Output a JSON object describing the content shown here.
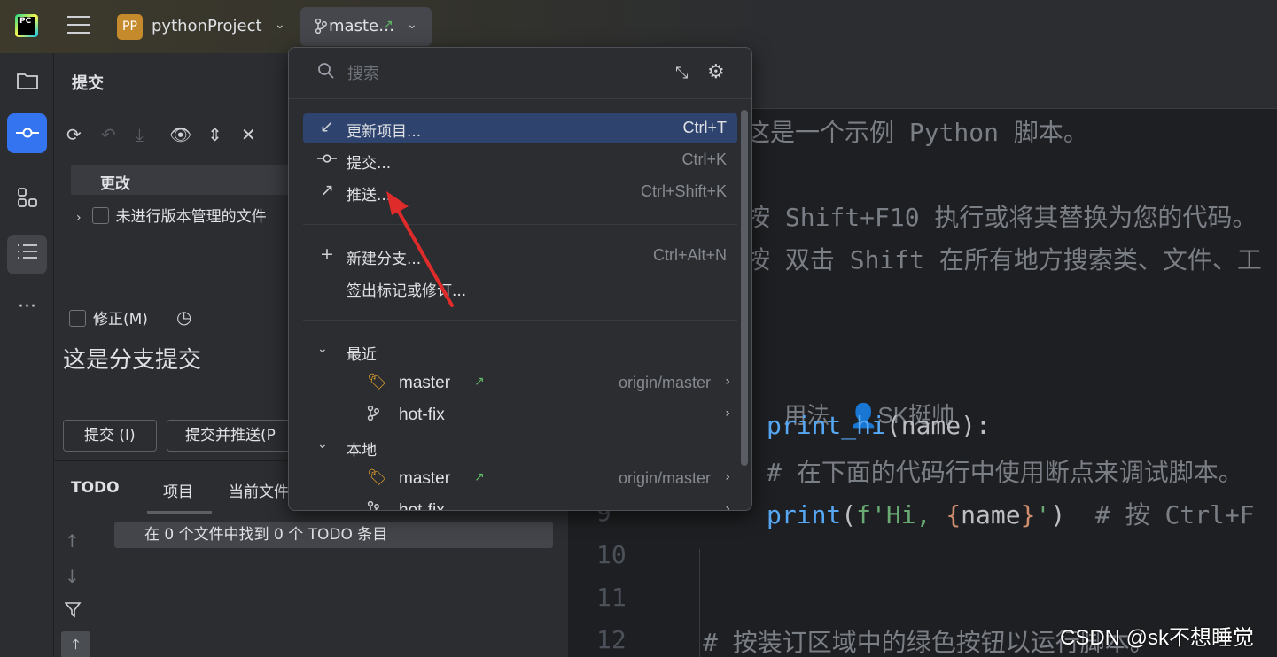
{
  "titlebar": {
    "logo_text": "PC",
    "project_badge": "PP",
    "project_name": "pythonProject",
    "branch_name": "maste…",
    "accent_color": "#3574f0"
  },
  "toolstrip": {
    "items": [
      "folder-icon",
      "commit-icon",
      "structure-icon",
      "list-icon",
      "more-icon"
    ],
    "more_label": "···"
  },
  "commit_panel": {
    "title": "提交",
    "changes_header": "更改",
    "unversioned_label": "未进行版本管理的文件",
    "amend_label": "修正(M)",
    "message": "这是分支提交",
    "commit_button": "提交 (I)",
    "commit_push_button": "提交并推送(P"
  },
  "todo_panel": {
    "tabs": [
      "TODO",
      "项目",
      "当前文件"
    ],
    "result_text": "在 0 个文件中找到 0 个 TODO 条目"
  },
  "editor": {
    "lines": [
      {
        "kind": "comment",
        "text": "这是一个示例 Python 脚本。"
      },
      {
        "kind": "comment",
        "text": "按 Shift+F10 执行或将其替换为您的代码。"
      },
      {
        "kind": "comment",
        "text": "按 双击 Shift 在所有地方搜索类、文件、工"
      },
      {
        "kind": "inlay",
        "usage": "用法",
        "author": "SK挺帅"
      },
      {
        "kind": "def",
        "fn": "print_hi",
        "rest": "(name):"
      },
      {
        "kind": "comment",
        "text": "# 在下面的代码行中使用断点来调试脚本。"
      },
      {
        "kind": "print",
        "fn": "print",
        "open": "(",
        "str1": "f'Hi, ",
        "brace1": "{",
        "var": "name",
        "brace2": "}",
        "str2": "'",
        "close": ")",
        "comment": "  # 按 Ctrl+F"
      },
      {
        "kind": "comment",
        "text": "# 按装订区域中的绿色按钮以运行脚本。"
      }
    ],
    "line_numbers": [
      "9",
      "10",
      "11",
      "12"
    ]
  },
  "popup": {
    "search_placeholder": "搜索",
    "actions": [
      {
        "icon": "update-icon",
        "label": "更新项目...",
        "shortcut": "Ctrl+T",
        "selected": true
      },
      {
        "icon": "commit-icon",
        "label": "提交...",
        "shortcut": "Ctrl+K",
        "selected": false
      },
      {
        "icon": "push-icon",
        "label": "推送...",
        "shortcut": "Ctrl+Shift+K",
        "selected": false
      }
    ],
    "actions2": [
      {
        "icon": "plus-icon",
        "label": "新建分支...",
        "shortcut": "Ctrl+Alt+N"
      },
      {
        "icon": "",
        "label": "签出标记或修订...",
        "shortcut": ""
      }
    ],
    "groups": [
      {
        "label": "最近",
        "branches": [
          {
            "name": "master",
            "remote": "origin/master",
            "icon": "tag-icon",
            "tracked": true
          },
          {
            "name": "hot-fix",
            "remote": "",
            "icon": "branch-icon",
            "tracked": false
          }
        ]
      },
      {
        "label": "本地",
        "branches": [
          {
            "name": "master",
            "remote": "origin/master",
            "icon": "tag-icon",
            "tracked": true
          },
          {
            "name": "hot-fix",
            "remote": "",
            "icon": "branch-icon",
            "tracked": false
          }
        ]
      }
    ]
  },
  "watermark": "CSDN @sk不想睡觉"
}
